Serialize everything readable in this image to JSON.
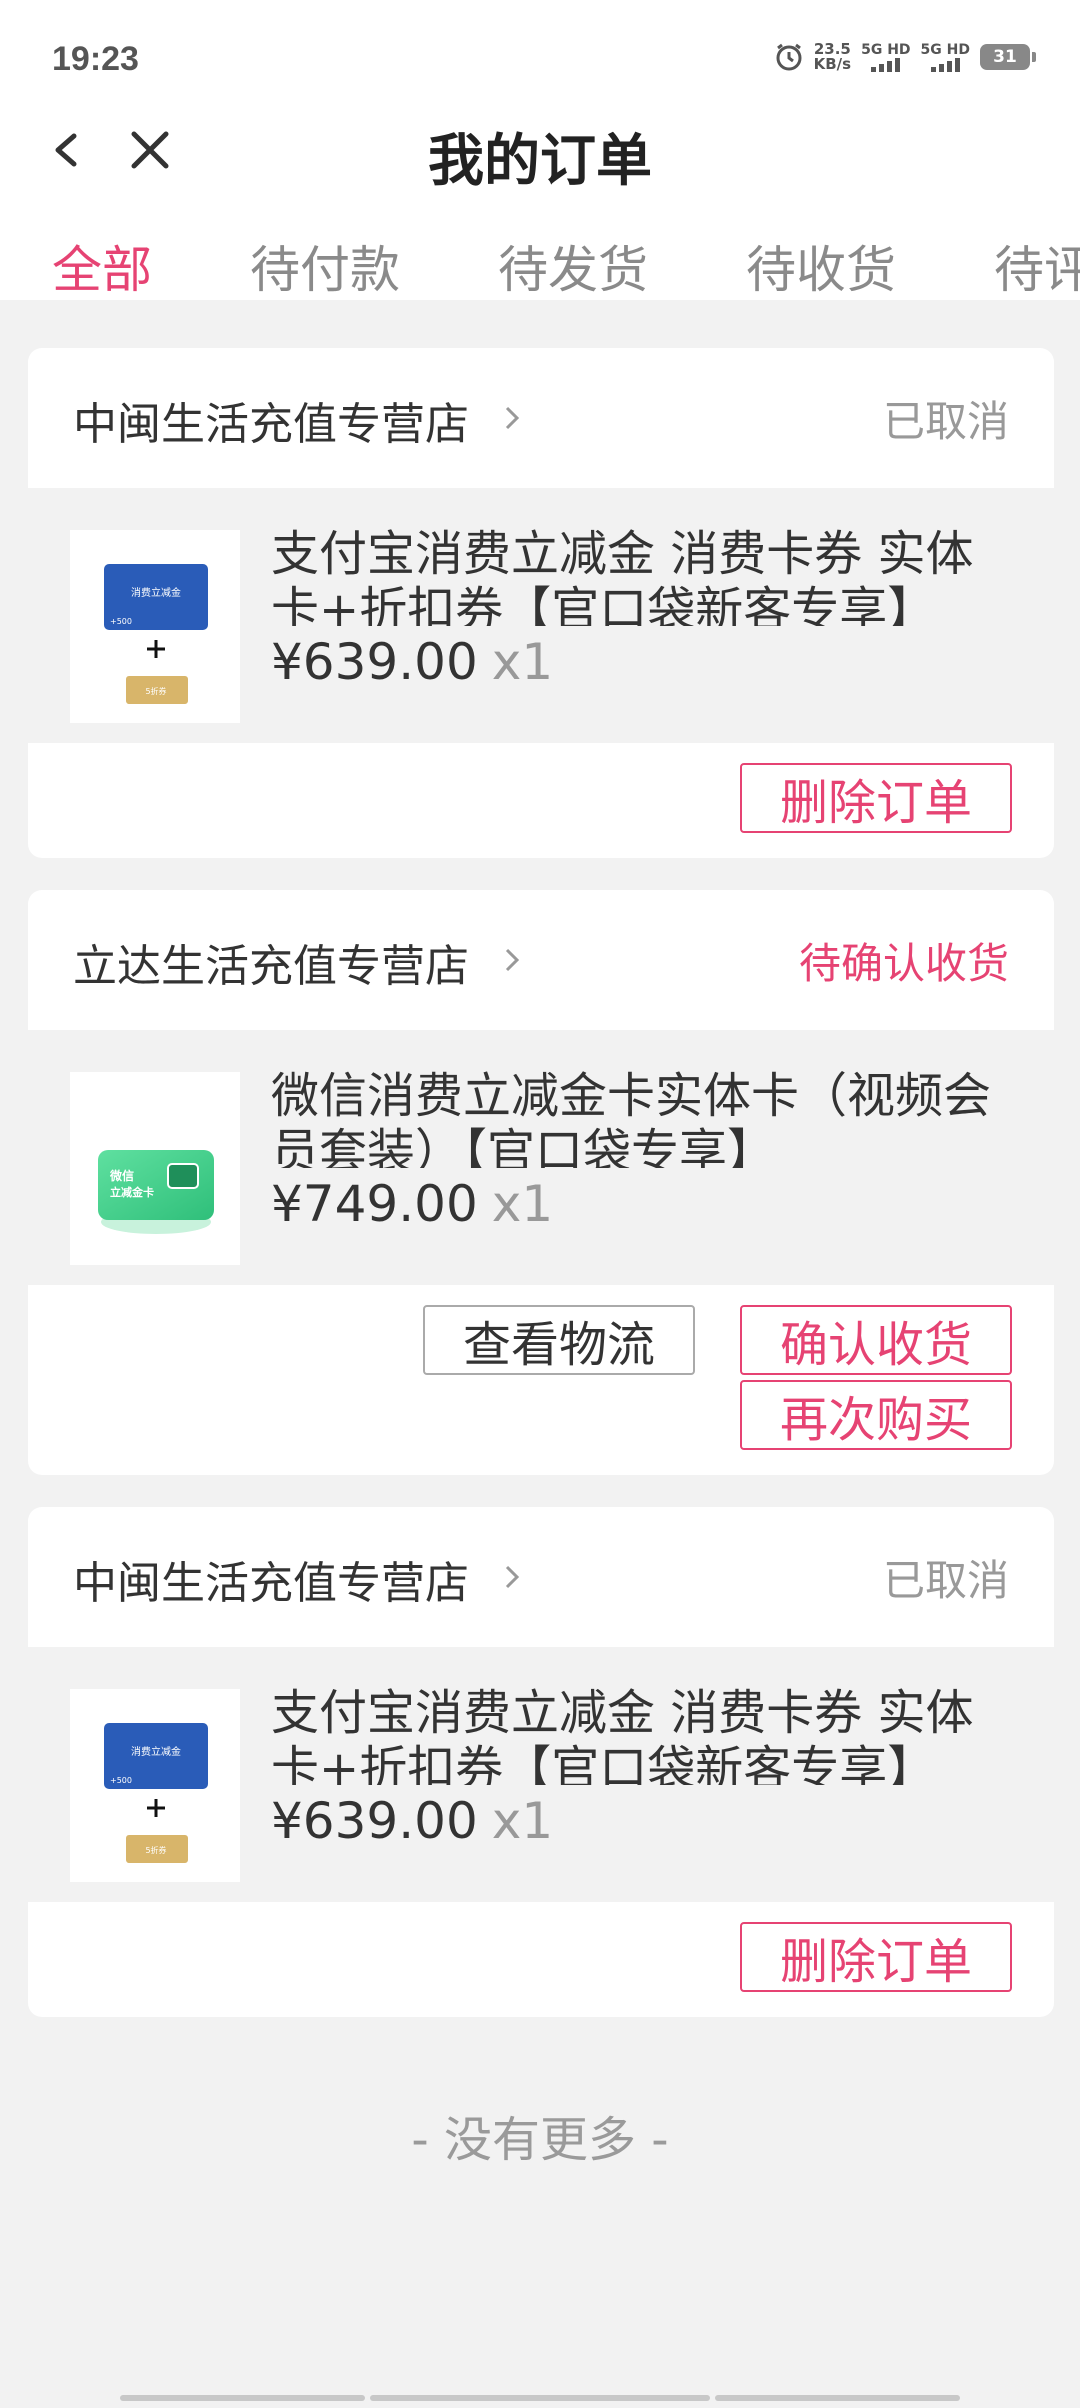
{
  "status_bar": {
    "time": "19:23",
    "net_speed_value": "23.5",
    "net_speed_unit": "KB/s",
    "sim1": "5G HD",
    "sim2": "5G HD",
    "battery": "31"
  },
  "header": {
    "title": "我的订单",
    "back_icon": "chevron-left-icon",
    "close_icon": "close-icon"
  },
  "tabs": [
    {
      "label": "全部",
      "active": true
    },
    {
      "label": "待付款",
      "active": false
    },
    {
      "label": "待发货",
      "active": false
    },
    {
      "label": "待收货",
      "active": false
    },
    {
      "label": "待评",
      "active": false
    }
  ],
  "orders": [
    {
      "shop": "中闽生活充值专营店",
      "status": "已取消",
      "item_title": "支付宝消费立减金 消费卡券 实体卡+折扣券【官口袋新客专享】",
      "price": "¥639.00",
      "qty": "x1",
      "thumb_card_label": "消费立减金",
      "thumb_card_amount": "+500",
      "thumb_coupon_label": "5折券",
      "buttons": [
        "删除订单"
      ]
    },
    {
      "shop": "立达生活充值专营店",
      "status": "待确认收货",
      "item_title": "微信消费立减金卡实体卡（视频会员套装）【官口袋专享】",
      "price": "¥749.00",
      "qty": "x1",
      "thumb_card_label_1": "微信",
      "thumb_card_label_2": "立减金卡",
      "buttons": [
        "查看物流",
        "确认收货",
        "再次购买"
      ]
    },
    {
      "shop": "中闽生活充值专营店",
      "status": "已取消",
      "item_title": "支付宝消费立减金 消费卡券 实体卡+折扣券【官口袋新客专享】",
      "price": "¥639.00",
      "qty": "x1",
      "thumb_card_label": "消费立减金",
      "thumb_card_amount": "+500",
      "thumb_coupon_label": "5折券",
      "buttons": [
        "删除订单"
      ]
    }
  ],
  "footer": {
    "no_more": "- 没有更多 -"
  },
  "colors": {
    "accent": "#e64373",
    "muted": "#999999",
    "background": "#f2f2f2"
  }
}
